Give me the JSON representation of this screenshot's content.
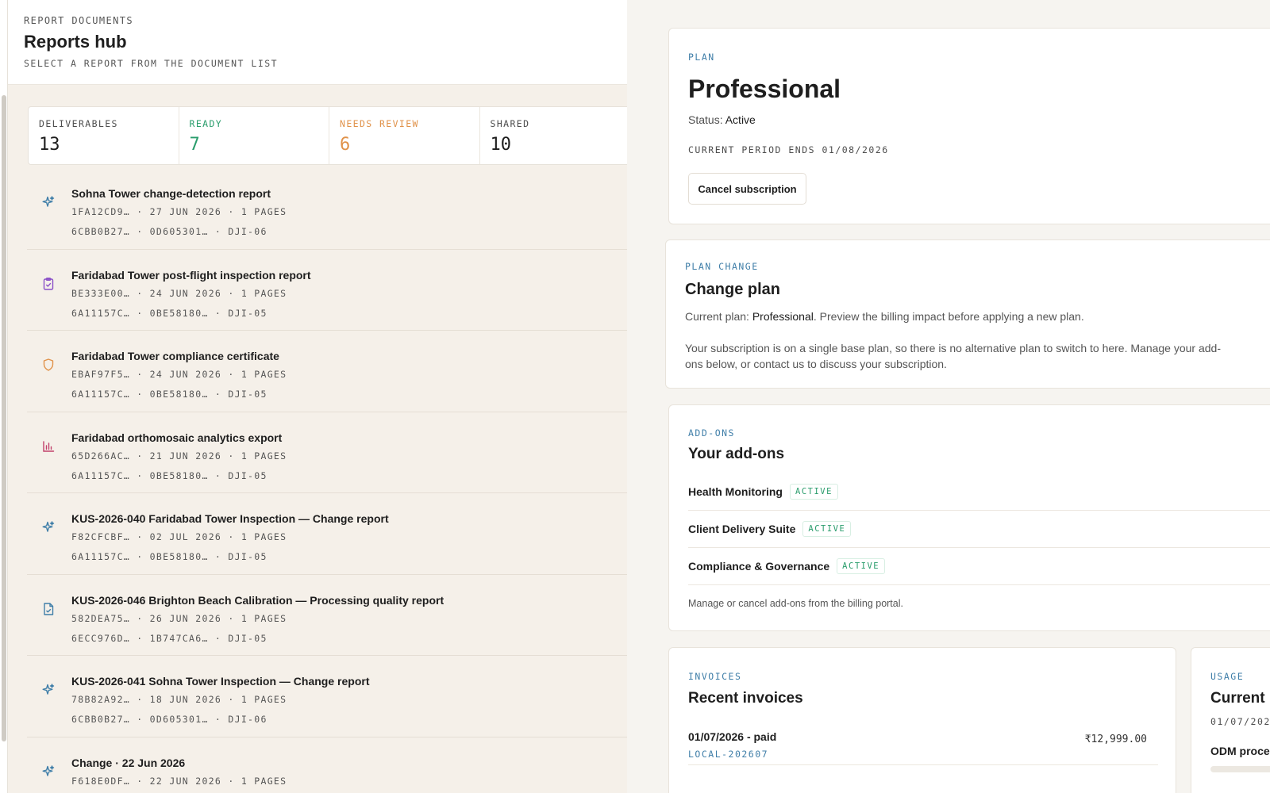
{
  "header": {
    "eyebrow": "REPORT DOCUMENTS",
    "title": "Reports hub",
    "subtitle": "SELECT A REPORT FROM THE DOCUMENT LIST"
  },
  "stats": [
    {
      "label": "DELIVERABLES",
      "value": "13"
    },
    {
      "label": "READY",
      "value": "7"
    },
    {
      "label": "NEEDS REVIEW",
      "value": "6"
    },
    {
      "label": "SHARED",
      "value": "10"
    }
  ],
  "documents": [
    {
      "icon": "sparkle-icon",
      "icon_color": "#3f7ea8",
      "title": "Sohna Tower change-detection report",
      "meta1": "1FA12CD9… · 27 JUN 2026 · 1 PAGES",
      "meta2": "6CBB0B27… · 0D605301… · DJI-06"
    },
    {
      "icon": "clipboard-check-icon",
      "icon_color": "#8a4fc7",
      "title": "Faridabad Tower post-flight inspection report",
      "meta1": "BE333E00… · 24 JUN 2026 · 1 PAGES",
      "meta2": "6A11157C… · 0BE58180… · DJI-05"
    },
    {
      "icon": "shield-icon",
      "icon_color": "#e0924a",
      "title": "Faridabad Tower compliance certificate",
      "meta1": "EBAF97F5… · 24 JUN 2026 · 1 PAGES",
      "meta2": "6A11157C… · 0BE58180… · DJI-05"
    },
    {
      "icon": "bar-chart-icon",
      "icon_color": "#c2416b",
      "title": "Faridabad orthomosaic analytics export",
      "meta1": "65D266AC… · 21 JUN 2026 · 1 PAGES",
      "meta2": "6A11157C… · 0BE58180… · DJI-05"
    },
    {
      "icon": "sparkle-icon",
      "icon_color": "#3f7ea8",
      "title": "KUS-2026-040 Faridabad Tower Inspection — Change report",
      "meta1": "F82CFCBF… · 02 JUL 2026 · 1 PAGES",
      "meta2": "6A11157C… · 0BE58180… · DJI-05"
    },
    {
      "icon": "file-check-icon",
      "icon_color": "#3f7ea8",
      "title": "KUS-2026-046 Brighton Beach Calibration — Processing quality report",
      "meta1": "582DEA75… · 26 JUN 2026 · 1 PAGES",
      "meta2": "6ECC976D… · 1B747CA6… · DJI-05"
    },
    {
      "icon": "sparkle-icon",
      "icon_color": "#3f7ea8",
      "title": "KUS-2026-041 Sohna Tower Inspection — Change report",
      "meta1": "78B82A92… · 18 JUN 2026 · 1 PAGES",
      "meta2": "6CBB0B27… · 0D605301… · DJI-06"
    },
    {
      "icon": "sparkle-icon",
      "icon_color": "#3f7ea8",
      "title": "Change · 22 Jun 2026",
      "meta1": "F618E0DF… · 22 JUN 2026 · 1 PAGES",
      "meta2": ""
    }
  ],
  "plan": {
    "eyebrow": "PLAN",
    "name": "Professional",
    "status_label": "Status:",
    "status_value": "Active",
    "period": "CURRENT PERIOD ENDS 01/08/2026",
    "cancel_label": "Cancel subscription"
  },
  "plan_change": {
    "eyebrow": "PLAN CHANGE",
    "title": "Change plan",
    "current_prefix": "Current plan:",
    "current_plan": "Professional",
    "current_suffix": ". Preview the billing impact before applying a new plan.",
    "note": "Your subscription is on a single base plan, so there is no alternative plan to switch to here. Manage your add-ons below, or contact us to discuss your subscription."
  },
  "addons": {
    "eyebrow": "ADD-ONS",
    "title": "Your add-ons",
    "items": [
      {
        "name": "Health Monitoring",
        "status": "ACTIVE"
      },
      {
        "name": "Client Delivery Suite",
        "status": "ACTIVE"
      },
      {
        "name": "Compliance & Governance",
        "status": "ACTIVE"
      }
    ],
    "footer": "Manage or cancel add-ons from the billing portal."
  },
  "invoices": {
    "eyebrow": "INVOICES",
    "title": "Recent invoices",
    "items": [
      {
        "date": "01/07/2026 - paid",
        "id": "LOCAL-202607",
        "amount": "₹12,999.00"
      },
      {
        "date": "",
        "id": "",
        "amount": ""
      }
    ]
  },
  "usage": {
    "eyebrow": "USAGE",
    "title": "Current I",
    "date": "01/07/202",
    "metric": "ODM proce",
    "progress_fraction": 0.0
  }
}
